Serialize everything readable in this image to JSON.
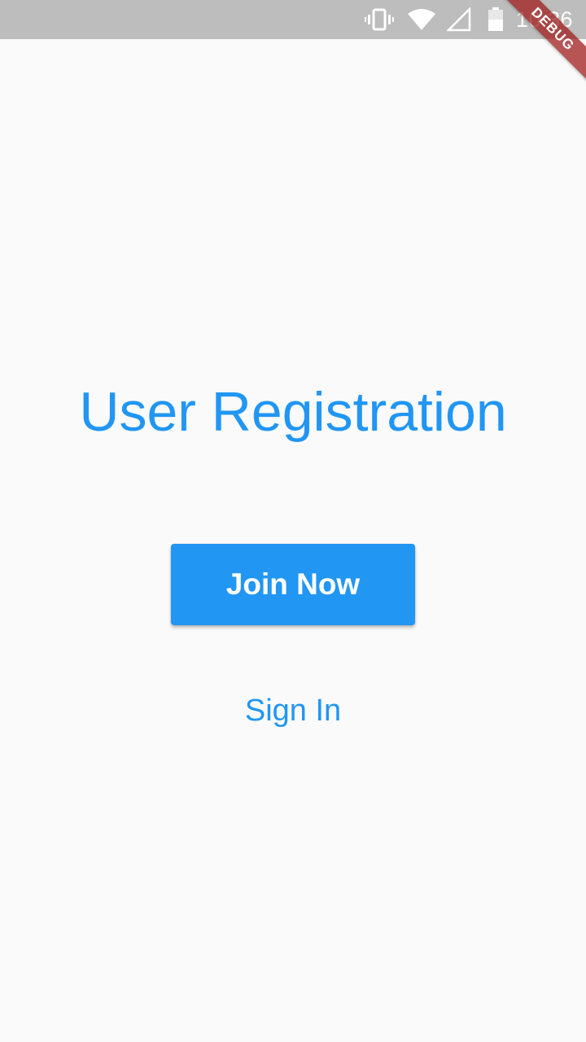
{
  "status_bar": {
    "time": "10:36",
    "icons": [
      "vibrate-icon",
      "wifi-icon",
      "signal-icon",
      "battery-icon"
    ]
  },
  "debug_banner": {
    "label": "DEBUG"
  },
  "main": {
    "title": "User Registration",
    "join_label": "Join Now",
    "signin_label": "Sign In"
  },
  "colors": {
    "accent": "#2196f3",
    "status_bar_bg": "#bdbdbd",
    "background": "#fafafa",
    "debug_ribbon": "#a01e1e"
  }
}
